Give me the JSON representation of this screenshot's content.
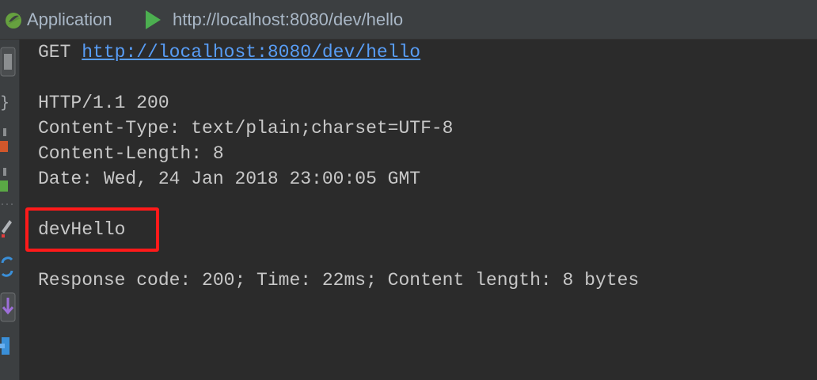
{
  "tabs": {
    "application": "Application",
    "request_url": "http://localhost:8080/dev/hello"
  },
  "request": {
    "method": "GET",
    "url": "http://localhost:8080/dev/hello"
  },
  "response": {
    "status_line": "HTTP/1.1 200",
    "headers": [
      "Content-Type: text/plain;charset=UTF-8",
      "Content-Length: 8",
      "Date: Wed, 24 Jan 2018 23:00:05 GMT"
    ],
    "body": "devHello",
    "summary": "Response code: 200; Time: 22ms; Content length: 8 bytes"
  },
  "colors": {
    "background": "#2b2b2b",
    "link": "#589df6",
    "highlight": "#ff1a1a",
    "run": "#4caf50"
  },
  "icons": [
    "spring-boot-icon",
    "run-icon",
    "stop-icon",
    "format-icon",
    "layout-icon",
    "edit-icon",
    "refresh-icon",
    "download-icon",
    "pin-icon"
  ]
}
